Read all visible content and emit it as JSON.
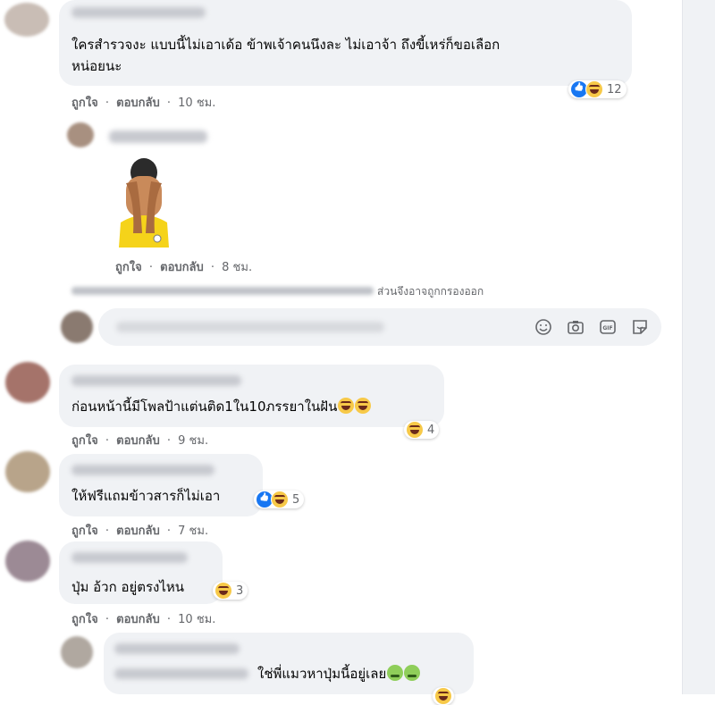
{
  "comments": [
    {
      "text": "ใครสำรวจงะ แบบนี้ไม่เอาเด้อ ข้าพเจ้าคนนึงละ ไม่เอาจ้า ถึงขี้เหร่ก็ขอเลือก",
      "text2": "หน่อยนะ",
      "like": "ถูกใจ",
      "reply": "ตอบกลับ",
      "time": "10 ชม.",
      "count": "12"
    },
    {
      "like": "ถูกใจ",
      "reply": "ตอบกลับ",
      "time": "8 ชม."
    },
    {
      "text": "ก่อนหน้านี้มีโพลป้าแต่นติด1ใน10ภรรยาในฝัน",
      "like": "ถูกใจ",
      "reply": "ตอบกลับ",
      "time": "9 ชม.",
      "count": "4"
    },
    {
      "text": "ให้ฟรีแถมข้าวสารก็ไม่เอา",
      "like": "ถูกใจ",
      "reply": "ตอบกลับ",
      "time": "7 ชม.",
      "count": "5"
    },
    {
      "text": "ปุ่ม อ้วก อยู่ตรงไหน",
      "like": "ถูกใจ",
      "reply": "ตอบกลับ",
      "time": "10 ชม.",
      "count": "3"
    },
    {
      "text": "ใช่พี่แมวหาปุ่มนี้อยู่เลย"
    }
  ],
  "notice": "ส่วนจึงอาจถูกกรองออก",
  "separator": "·",
  "icons": [
    "emoji-icon",
    "camera-icon",
    "gif-icon",
    "sticker-icon"
  ],
  "colors": {
    "bubble": "#f0f2f5",
    "meta": "#65676b",
    "like_blue": "#1877f2"
  }
}
